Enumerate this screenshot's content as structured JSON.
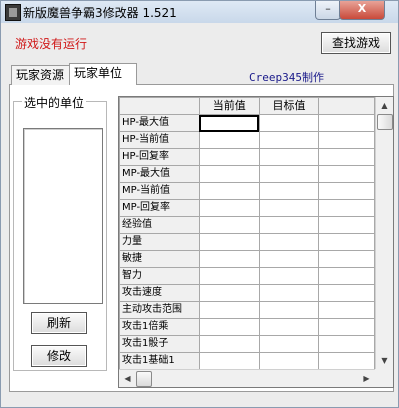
{
  "window": {
    "title": "新版魔兽争霸3修改器 1.521",
    "min_label": "–",
    "close_label": "X"
  },
  "status": {
    "text": "游戏没有运行",
    "color": "#d01818"
  },
  "find_game_button": "查找游戏",
  "tabs": [
    {
      "label": "玩家资源"
    },
    {
      "label": "玩家单位"
    }
  ],
  "credit": "Creep345制作",
  "selected_units": {
    "title": "选中的单位",
    "refresh_label": "刷新",
    "modify_label": "修改"
  },
  "grid": {
    "columns": [
      "当前值",
      "目标值"
    ],
    "rows": [
      "HP-最大值",
      "HP-当前值",
      "HP-回复率",
      "MP-最大值",
      "MP-当前值",
      "MP-回复率",
      "经验值",
      "力量",
      "敏捷",
      "智力",
      "攻击速度",
      "主动攻击范围",
      "攻击1倍乘",
      "攻击1骰子",
      "攻击1基础1"
    ]
  }
}
